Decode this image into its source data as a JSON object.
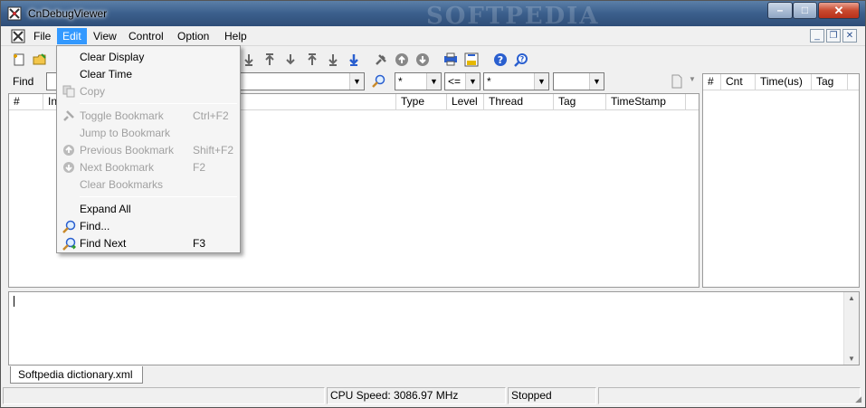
{
  "window": {
    "title": "CnDebugViewer",
    "watermark": "SOFTPEDIA",
    "buttons": {
      "minimize": "–",
      "maximize": "□",
      "close": "✕"
    }
  },
  "menubar": {
    "items": [
      "File",
      "Edit",
      "View",
      "Control",
      "Option",
      "Help"
    ],
    "active": "Edit",
    "mdi": {
      "minimize": "_",
      "restore": "❐",
      "close": "✕"
    }
  },
  "find": {
    "label": "Find",
    "type_value": "*",
    "level_value": "<=",
    "thread_value": "*",
    "tag_value": ""
  },
  "main_columns": [
    "#",
    "In",
    "Type",
    "Level",
    "Thread",
    "Tag",
    "TimeStamp"
  ],
  "side_columns": [
    "#",
    "Cnt",
    "Time(us)",
    "Tag"
  ],
  "edit_menu": {
    "items": [
      {
        "label": "Clear Display",
        "shortcut": "",
        "enabled": true,
        "icon": ""
      },
      {
        "label": "Clear Time",
        "shortcut": "",
        "enabled": true,
        "icon": ""
      },
      {
        "label": "Copy",
        "shortcut": "",
        "enabled": false,
        "icon": "copy-icon"
      },
      {
        "label": "Toggle Bookmark",
        "shortcut": "Ctrl+F2",
        "enabled": false,
        "icon": "pin-icon"
      },
      {
        "label": "Jump to Bookmark",
        "shortcut": "",
        "enabled": false,
        "icon": ""
      },
      {
        "label": "Previous Bookmark",
        "shortcut": "Shift+F2",
        "enabled": false,
        "icon": "arrow-up-circle-icon"
      },
      {
        "label": "Next Bookmark",
        "shortcut": "F2",
        "enabled": false,
        "icon": "arrow-down-circle-icon"
      },
      {
        "label": "Clear Bookmarks",
        "shortcut": "",
        "enabled": false,
        "icon": ""
      },
      {
        "label": "Expand All",
        "shortcut": "",
        "enabled": true,
        "icon": ""
      },
      {
        "label": "Find...",
        "shortcut": "",
        "enabled": true,
        "icon": "magnifier-icon"
      },
      {
        "label": "Find Next",
        "shortcut": "F3",
        "enabled": true,
        "icon": "magnifier-next-icon"
      }
    ]
  },
  "log_tab": "Softpedia dictionary.xml",
  "status": {
    "cpu": "CPU Speed: 3086.97 MHz",
    "state": "Stopped"
  },
  "colors": {
    "title_bar": "#3b5f8c",
    "menu_highlight": "#3399ff",
    "close_button": "#c94a2f"
  }
}
